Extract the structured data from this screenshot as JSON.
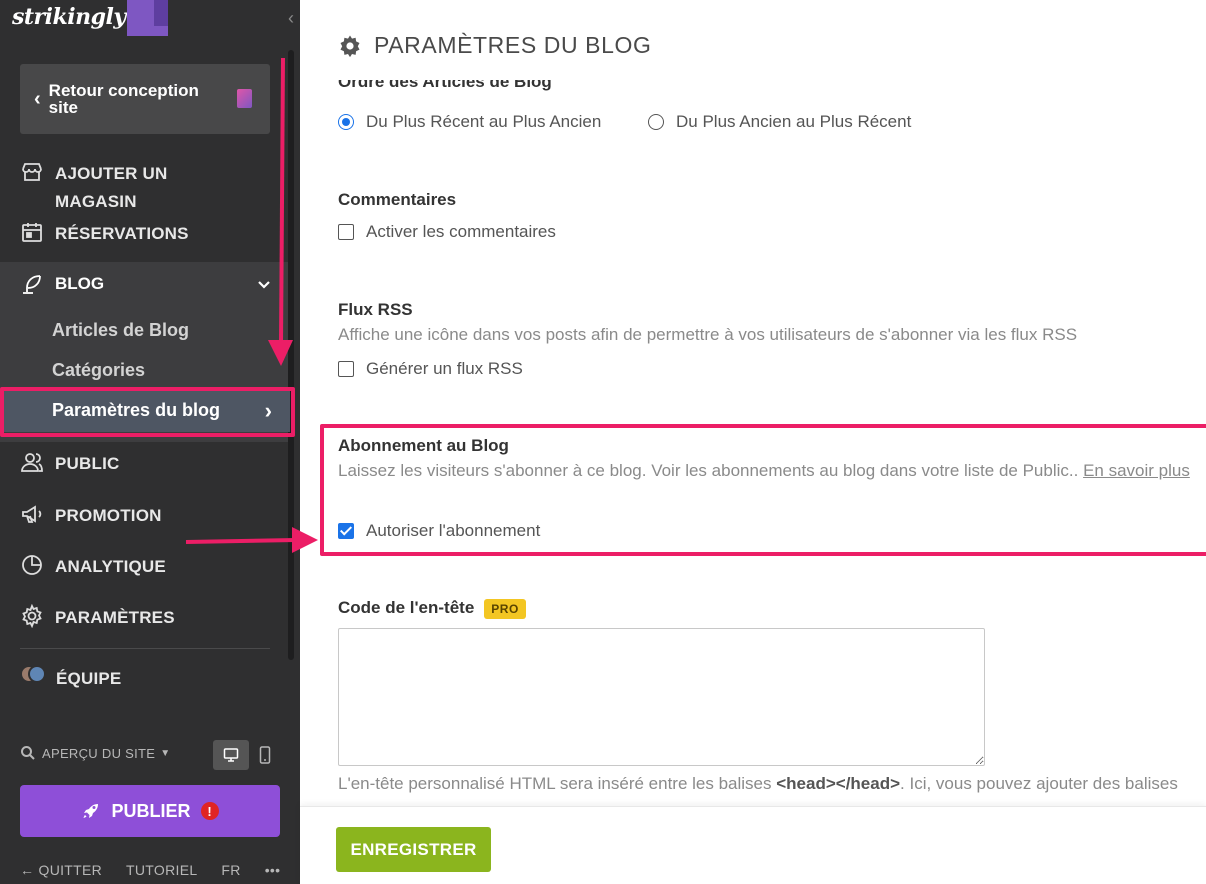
{
  "brand": {
    "name": "strikingly"
  },
  "sidebar": {
    "back_label": "Retour conception site",
    "items": {
      "store": "AJOUTER UN MAGASIN",
      "reservations": "RÉSERVATIONS",
      "blog": "BLOG",
      "public": "PUBLIC",
      "promotion": "PROMOTION",
      "analytics": "ANALYTIQUE",
      "settings": "PARAMÈTRES",
      "team": "ÉQUIPE"
    },
    "blog_sub": {
      "articles": "Articles de Blog",
      "categories": "Catégories",
      "settings": "Paramètres du blog"
    },
    "preview_label": "APERÇU DU SITE",
    "publish_label": "PUBLIER",
    "publish_alert": "!",
    "footer": {
      "quit": "QUITTER",
      "tutorial": "TUTORIEL",
      "lang": "FR",
      "more": "•••"
    }
  },
  "main": {
    "title": "PARAMÈTRES DU BLOG",
    "order": {
      "title": "Ordre des Articles de Blog",
      "option_newest": "Du Plus Récent au Plus Ancien",
      "option_oldest": "Du Plus Ancien au Plus Récent"
    },
    "comments": {
      "title": "Commentaires",
      "checkbox_label": "Activer les commentaires"
    },
    "rss": {
      "title": "Flux RSS",
      "description": "Affiche une icône dans vos posts afin de permettre à vos utilisateurs de s'abonner via les flux RSS",
      "checkbox_label": "Générer un flux RSS"
    },
    "subscription": {
      "title": "Abonnement au Blog",
      "description": "Laissez les visiteurs s'abonner à ce blog. Voir les abonnements au blog dans votre liste de Public.. ",
      "link": "En savoir plus",
      "checkbox_label": "Autoriser l'abonnement"
    },
    "header_code": {
      "title": "Code de l'en-tête",
      "badge": "PRO",
      "help_before": "L'en-tête personnalisé HTML sera inséré entre les balises ",
      "help_tag": "<head></head>",
      "help_after": ". Ici, vous pouvez ajouter des balises"
    },
    "save_label": "ENREGISTRER"
  },
  "colors": {
    "accent": "#ec1e66",
    "publish": "#8e4fd8",
    "save": "#8bb51e",
    "pro": "#f3c623"
  }
}
